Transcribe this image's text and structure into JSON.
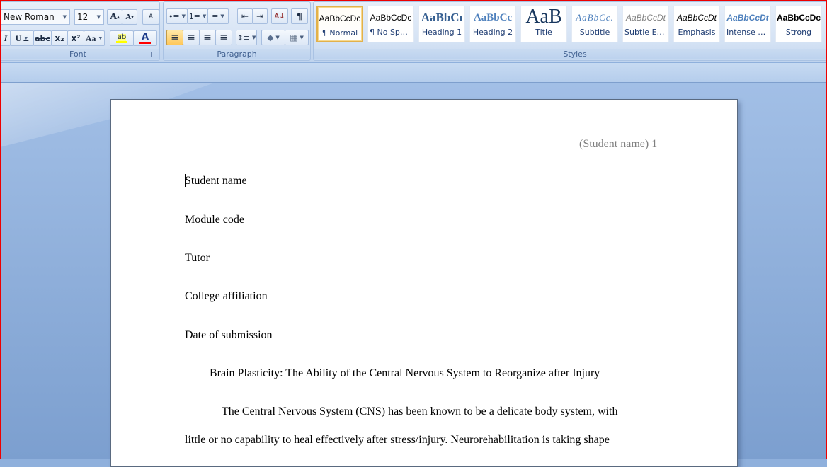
{
  "ribbon": {
    "font": {
      "label": "Font",
      "font_name": "New Roman",
      "font_size": "12",
      "grow_font": "A",
      "shrink_font": "A",
      "clear_formatting": "A",
      "italic": "I",
      "underline": "U",
      "strikethrough": "abc",
      "subscript": "x₂",
      "superscript": "x²",
      "change_case": "Aa",
      "highlight": "ab",
      "font_color": "A",
      "highlight_color": "#ffff00",
      "font_color_value": "#ff0000"
    },
    "paragraph": {
      "label": "Paragraph",
      "bullets": "•≡",
      "numbering": "1≡",
      "multilevel": "≡",
      "decrease_indent": "⇤",
      "increase_indent": "⇥",
      "sort": "A↓",
      "show_marks": "¶",
      "align_left": "≡",
      "align_center": "≡",
      "align_right": "≡",
      "justify": "≡",
      "line_spacing": "↕≡",
      "shading": "◆",
      "borders": "▦"
    },
    "styles": {
      "label": "Styles",
      "items": [
        {
          "sample": "AaBbCcDc",
          "name": "¶ Normal",
          "selected": true
        },
        {
          "sample": "AaBbCcDc",
          "name": "¶ No Spaci..."
        },
        {
          "sample": "AaBbCı",
          "name": "Heading 1"
        },
        {
          "sample": "AaBbCc",
          "name": "Heading 2"
        },
        {
          "sample": "AaB",
          "name": "Title"
        },
        {
          "sample": "AaBbCc.",
          "name": "Subtitle"
        },
        {
          "sample": "AaBbCcDt",
          "name": "Subtle Em..."
        },
        {
          "sample": "AaBbCcDt",
          "name": "Emphasis"
        },
        {
          "sample": "AaBbCcDt",
          "name": "Intense E..."
        },
        {
          "sample": "AaBbCcDc",
          "name": "Strong"
        }
      ]
    }
  },
  "document": {
    "header": "(Student name) 1",
    "lines": [
      "Student name",
      "Module code",
      "Tutor",
      "College affiliation",
      "Date of submission"
    ],
    "title": "Brain Plasticity: The Ability of the Central Nervous System to Reorganize after Injury",
    "body": [
      "The Central Nervous System (CNS)  has been known to be a delicate body system, with",
      "little or no capability to heal effectively after stress/injury. Neurorehabilitation is taking shape"
    ]
  }
}
